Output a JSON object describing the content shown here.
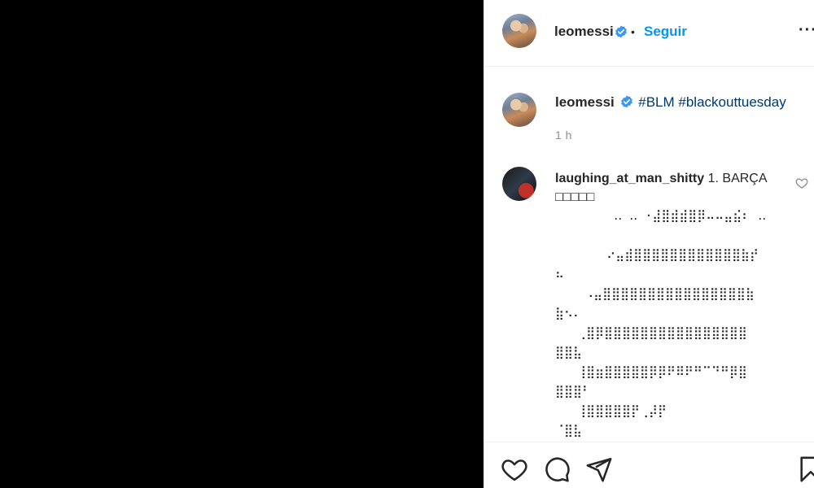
{
  "post": {
    "username": "leomessi",
    "separator": "•",
    "follow_label": "Seguir",
    "more_label": "···"
  },
  "caption": {
    "username": "leomessi",
    "hashtags": [
      "#BLM",
      "#blackouttuesday"
    ],
    "time": "1 h"
  },
  "comment": {
    "username": "laughing_at_man_shitty",
    "text": "1. BARÇA",
    "boxes": "□□□□□",
    "ascii_art": "        ‥ ‥ ⋅⣼⣿⣾⣾⣿⡿⠤⠤⣤⣮⠆ ‥\n\n       ⠔⣤⣾⣿⣿⣿⣿⣿⣿⣿⣿⣿⣿⣿⣿⣷⡞\n⠦\n    ⠠⣤⣿⣿⣿⣿⣿⣿⣿⣿⣿⣿⣿⣿⣿⣿⣿⣿⣷\n⣷⠢⠄\n   ⢀⣿⡿⣿⣿⣿⣿⣿⣿⣿⣿⣿⣿⣿⣿⣿⣿⣿⣿\n⣿⣿⣧\n   ⢸⣿⣶⣿⣿⣿⣿⣿⡿⡿⠟⠿⠟⠛⠉⠙⠛⡿⣿\n⣿⣿⣿⠃\n   ⢸⣿⣿⣿⣿⣿⡟⢀⡼⡟\n⠈⣿⣧"
  },
  "colors": {
    "link": "#0095f6",
    "hashtag": "#00376b",
    "text": "#262626",
    "muted": "#8e8e8e",
    "verified": "#3897f0"
  },
  "icons": {
    "like": "heart-icon",
    "comment": "comment-icon",
    "share": "send-icon",
    "save": "bookmark-icon"
  }
}
